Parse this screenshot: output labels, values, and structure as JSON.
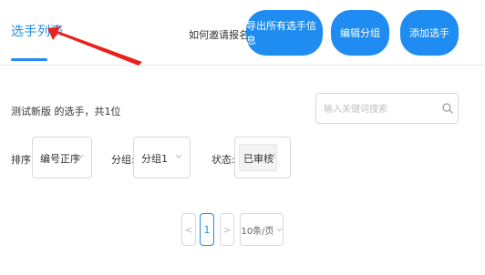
{
  "header": {
    "tab_label": "选手列表",
    "invite_link": "如何邀请报名?",
    "buttons": {
      "export": "导出所有选手信息",
      "edit_group": "编辑分组",
      "add_player": "添加选手"
    }
  },
  "summary": "测试新版 的选手，共1位",
  "search": {
    "placeholder": "输入关键词搜索",
    "value": ""
  },
  "filters": {
    "sort_label": "排序:",
    "sort_value": "编号正序",
    "group_label": "分组:",
    "group_value": "分组1",
    "status_label": "状态:",
    "status_tag": "已审核",
    "status_tag_remove": "×"
  },
  "pagination": {
    "prev": "<",
    "current_page": "1",
    "next": ">",
    "page_size": "10条/页"
  },
  "colors": {
    "accent": "#1e8cf0",
    "annotation_arrow": "#e8231e"
  },
  "icons": {
    "search": "search-icon",
    "chevron": "chevron-down-icon",
    "annotation": "red-arrow"
  }
}
